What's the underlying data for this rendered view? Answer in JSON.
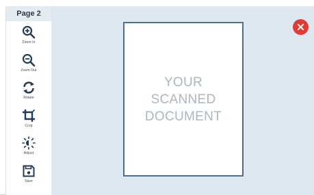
{
  "sidebar": {
    "page_label": "Page 2",
    "tools": [
      {
        "label": "Zoom In",
        "icon": "zoom-in-icon"
      },
      {
        "label": "Zoom Out",
        "icon": "zoom-out-icon"
      },
      {
        "label": "Rotate",
        "icon": "rotate-icon"
      },
      {
        "label": "Crop",
        "icon": "crop-icon"
      },
      {
        "label": "Adjust",
        "icon": "adjust-icon"
      },
      {
        "label": "Save",
        "icon": "save-icon"
      }
    ]
  },
  "document": {
    "line1": "YOUR",
    "line2": "SCANNED",
    "line3": "DOCUMENT"
  },
  "colors": {
    "accent": "#1f3a5a",
    "canvas": "#dde8f1",
    "close": "#e53935"
  }
}
